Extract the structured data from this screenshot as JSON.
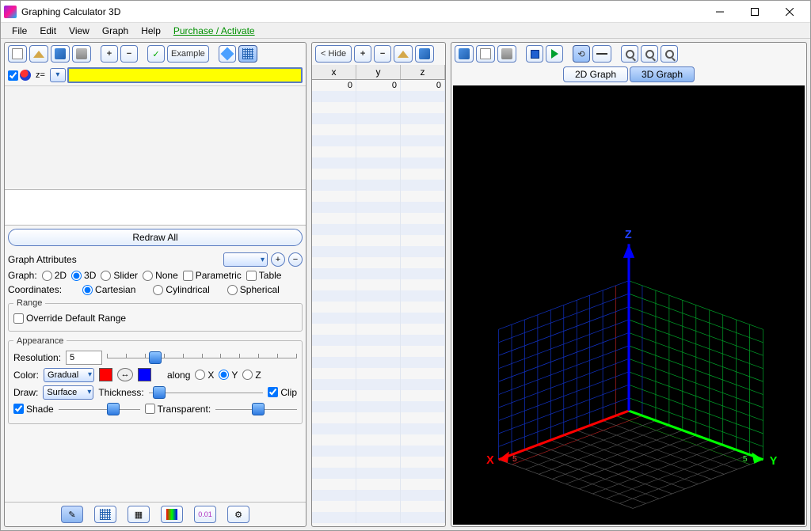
{
  "title": "Graphing Calculator 3D",
  "menu": [
    "File",
    "Edit",
    "View",
    "Graph",
    "Help",
    "Purchase / Activate"
  ],
  "left_toolbar": {
    "example_label": "Example"
  },
  "mid_toolbar": {
    "hide_label": "< Hide"
  },
  "equation": {
    "label": "z=",
    "value": ""
  },
  "redraw_label": "Redraw All",
  "attributes": {
    "title": "Graph Attributes",
    "graph_label": "Graph:",
    "graph_modes": [
      "2D",
      "3D",
      "Slider",
      "None"
    ],
    "graph_selected": "3D",
    "parametric_label": "Parametric",
    "table_label": "Table",
    "coords_label": "Coordinates:",
    "coords_options": [
      "Cartesian",
      "Cylindrical",
      "Spherical"
    ],
    "coords_selected": "Cartesian",
    "range_legend": "Range",
    "override_label": "Override Default Range",
    "appearance_legend": "Appearance",
    "resolution_label": "Resolution:",
    "resolution_value": "5",
    "color_label": "Color:",
    "color_mode": "Gradual",
    "color_from": "#ff0000",
    "color_to": "#0000ff",
    "along_label": "along",
    "along_axes": [
      "X",
      "Y",
      "Z"
    ],
    "along_selected": "Y",
    "draw_label": "Draw:",
    "draw_mode": "Surface",
    "thickness_label": "Thickness:",
    "clip_label": "Clip",
    "shade_label": "Shade",
    "transparent_label": "Transparent:"
  },
  "data_table": {
    "headers": [
      "x",
      "y",
      "z"
    ],
    "rows": [
      [
        "0",
        "0",
        "0"
      ]
    ]
  },
  "right": {
    "tabs": [
      "2D Graph",
      "3D Graph"
    ],
    "active_tab": "3D Graph",
    "axes": {
      "x": "X",
      "y": "Y",
      "z": "Z",
      "tick": "5"
    }
  }
}
